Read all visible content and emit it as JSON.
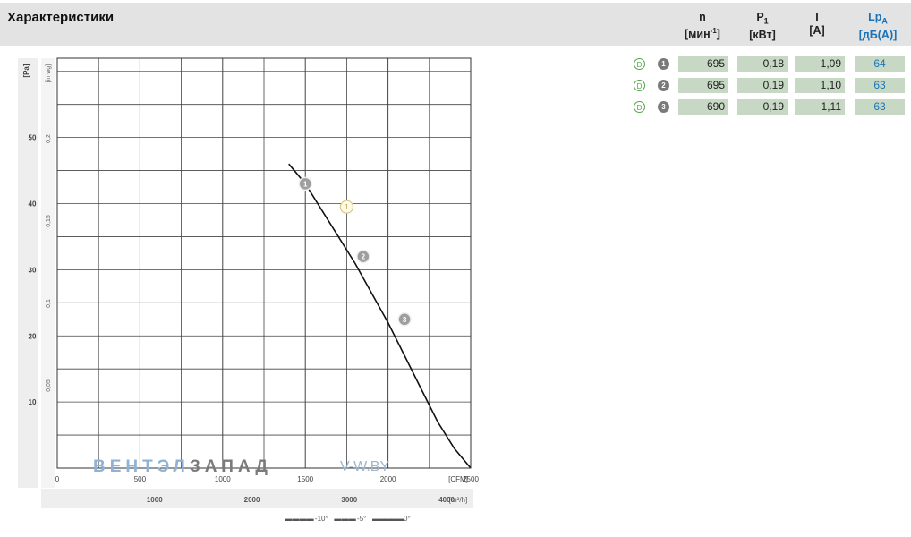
{
  "header": {
    "title": "Характеристики",
    "columns": [
      {
        "symbol": "n",
        "unit": "[мин",
        "unit_sup": "-1",
        "unit_end": "]"
      },
      {
        "symbol": "P",
        "sub": "1",
        "unit": "[кВт]"
      },
      {
        "symbol": "I",
        "unit": "[А]"
      },
      {
        "symbol": "Lp",
        "sub": "A",
        "unit": "[дБ(А)]"
      }
    ]
  },
  "table": {
    "rows": [
      {
        "d": "D",
        "num": "1",
        "n": "695",
        "p1": "0,18",
        "i": "1,09",
        "lpa": "64"
      },
      {
        "d": "D",
        "num": "2",
        "n": "695",
        "p1": "0,19",
        "i": "1,10",
        "lpa": "63"
      },
      {
        "d": "D",
        "num": "3",
        "n": "690",
        "p1": "0,19",
        "i": "1,11",
        "lpa": "63"
      }
    ]
  },
  "chart_data": {
    "type": "line",
    "x_unit": "[CFM]",
    "x_ticks": [
      "0",
      "500",
      "1000",
      "1500",
      "2000",
      "2500"
    ],
    "x2_ticks": [
      "1000",
      "2000",
      "3000",
      "4000"
    ],
    "x2_unit": "[m³/h]",
    "y_ticks": [
      "10",
      "20",
      "30",
      "40",
      "50"
    ],
    "y_unit": "[Pa]",
    "y2_ticks": [
      "0,05",
      "0,1",
      "0,15",
      "0,2"
    ],
    "y2_unit": "[in wg]",
    "xlim": [
      0,
      2500
    ],
    "ylim": [
      0,
      62
    ],
    "grid": true,
    "series": [
      {
        "x": [
          1400,
          1500,
          1600,
          1700,
          1800,
          1900,
          2000,
          2100,
          2200,
          2300,
          2400,
          2500
        ],
        "y": [
          46,
          43,
          39,
          35,
          31,
          26.5,
          22,
          17,
          12,
          7,
          3,
          0
        ]
      }
    ],
    "operating_points": [
      {
        "label": "1",
        "x": 1500,
        "y": 43
      },
      {
        "label": "2",
        "x": 1850,
        "y": 32
      },
      {
        "label": "3",
        "x": 2100,
        "y": 22.5
      }
    ],
    "limit_point": {
      "label": "1",
      "x": 1750,
      "y": 39.5
    },
    "legend": [
      "-10°",
      "-5°",
      "0°"
    ]
  },
  "watermark": {
    "brand_blue": "ВЕНТЭЛ",
    "brand_grey": "ЗАПАД",
    "site": "V-W.BY"
  }
}
